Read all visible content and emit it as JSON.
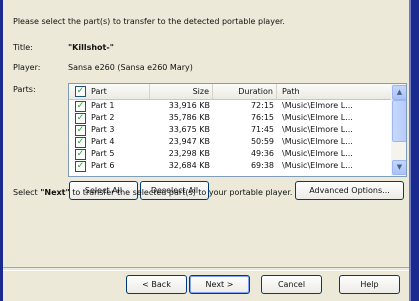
{
  "dialog": {
    "instruction": "Please select the part(s) to transfer to the detected portable player.",
    "title_label": "Title:",
    "title_value": "\"Killshot-\"",
    "player_label": "Player:",
    "player_value": "Sansa e260 (Sansa e260 Mary)",
    "parts_label": "Parts:"
  },
  "list": {
    "columns": {
      "part": "Part",
      "size": "Size",
      "duration": "Duration",
      "path": "Path"
    },
    "rows": [
      {
        "part": "Part 1",
        "size": "33,916 KB",
        "duration": "72:15",
        "path": "\\Music\\Elmore L...",
        "checked": true
      },
      {
        "part": "Part 2",
        "size": "35,786 KB",
        "duration": "76:15",
        "path": "\\Music\\Elmore L...",
        "checked": true
      },
      {
        "part": "Part 3",
        "size": "33,675 KB",
        "duration": "71:45",
        "path": "\\Music\\Elmore L...",
        "checked": true
      },
      {
        "part": "Part 4",
        "size": "23,947 KB",
        "duration": "50:59",
        "path": "\\Music\\Elmore L...",
        "checked": true
      },
      {
        "part": "Part 5",
        "size": "23,298 KB",
        "duration": "49:36",
        "path": "\\Music\\Elmore L...",
        "checked": true
      },
      {
        "part": "Part 6",
        "size": "32,684 KB",
        "duration": "69:38",
        "path": "\\Music\\Elmore L...",
        "checked": true
      }
    ],
    "scroll_up_glyph": "▲",
    "scroll_down_glyph": "▼",
    "check_glyph": "✓"
  },
  "buttons": {
    "select_all": "Select All",
    "deselect_all": "Deselect All",
    "advanced": "Advanced Options...",
    "back": "< Back",
    "next": "Next >",
    "cancel": "Cancel",
    "help": "Help"
  },
  "hint": {
    "before": "Select ",
    "emphasis": "\"Next\"",
    "after": " to transfer the selected part(s) to your portable player."
  },
  "colors": {
    "frame": "#1b2a8f",
    "panel": "#ece9d8",
    "button_border": "#003c74",
    "check": "#21a121"
  }
}
